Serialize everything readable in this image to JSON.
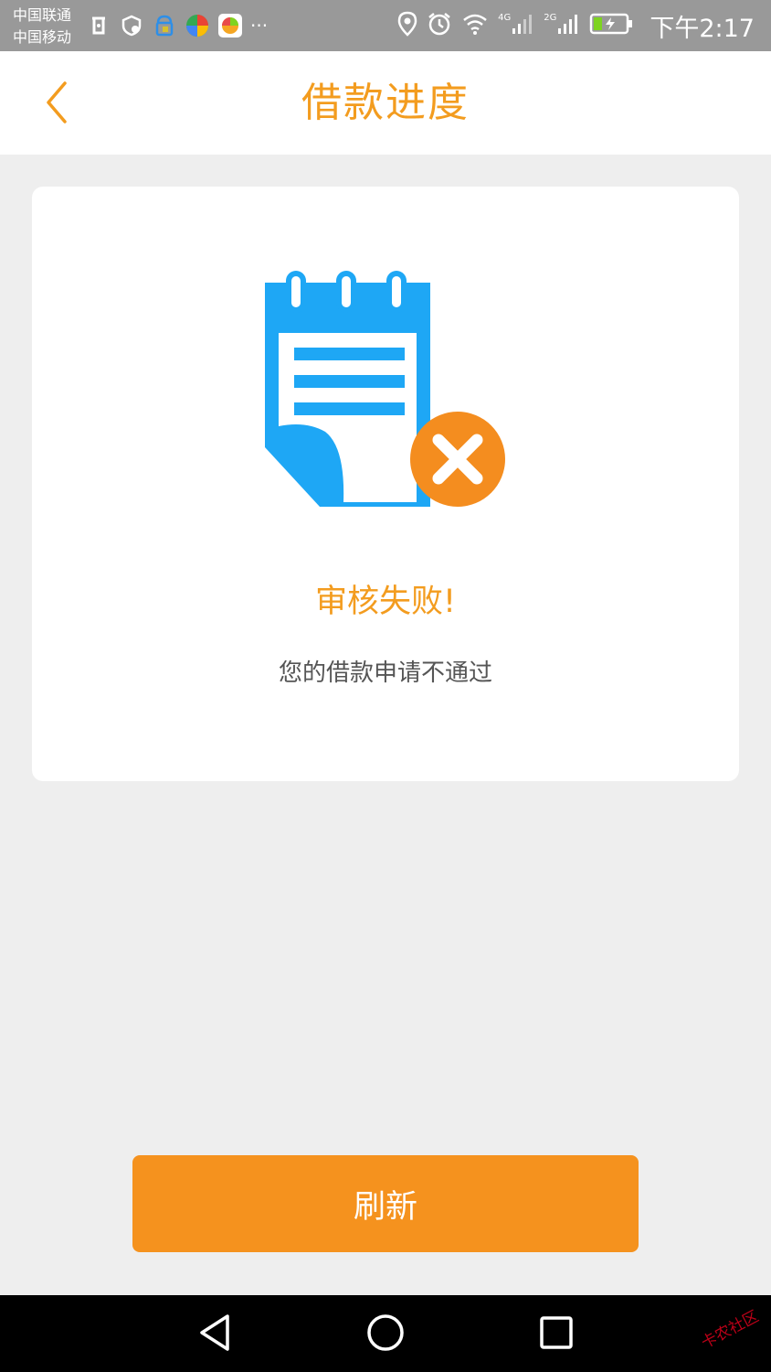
{
  "status_bar": {
    "carrier_1": "中国联通",
    "carrier_2": "中国移动",
    "more": "···",
    "signal_1_label": "4G",
    "signal_2_label": "2G",
    "time": "下午2:17",
    "icons": [
      "antenna-icon",
      "shield-icon",
      "bag-icon",
      "app-icon-1",
      "app-icon-2",
      "location-icon",
      "alarm-icon",
      "wifi-icon",
      "signal-icon",
      "signal-icon",
      "battery-charging-icon"
    ]
  },
  "header": {
    "title": "借款进度",
    "back_icon": "chevron-left-icon"
  },
  "result": {
    "illustration_icon": "notepad-failed-icon",
    "title": "审核失败!",
    "description": "您的借款申请不通过"
  },
  "actions": {
    "refresh_label": "刷新"
  },
  "nav_bar": {
    "back_icon": "triangle-back-icon",
    "home_icon": "circle-home-icon",
    "recent_icon": "square-recent-icon"
  },
  "watermark": {
    "text": "卡农社区"
  },
  "colors": {
    "accent": "#f39c1f",
    "button": "#f5921e",
    "illustration_blue": "#1ea7f5",
    "fail_orange": "#f48d1f",
    "background": "#eeeeee"
  }
}
